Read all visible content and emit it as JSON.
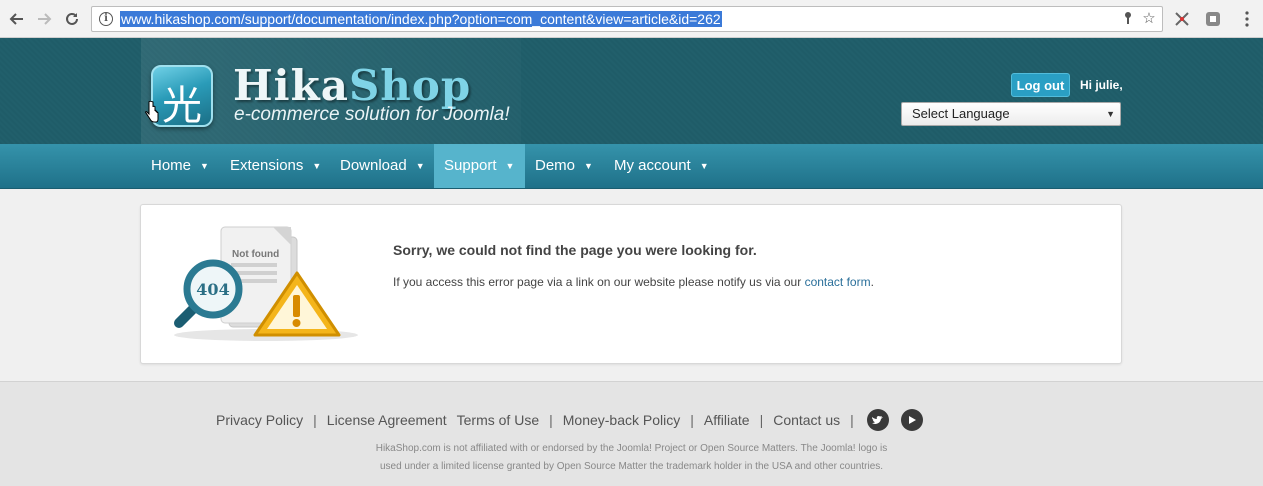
{
  "browser": {
    "url": "www.hikashop.com/support/documentation/index.php?option=com_content&view=article&id=262"
  },
  "header": {
    "logo_word_1": "Hika",
    "logo_word_2": "Shop",
    "tagline": "e-commerce solution for Joomla!",
    "logout_label": "Log out",
    "greeting": "Hi julie,",
    "language_select": "Select Language"
  },
  "menu": {
    "items": [
      {
        "label": "Home"
      },
      {
        "label": "Extensions"
      },
      {
        "label": "Download"
      },
      {
        "label": "Support"
      },
      {
        "label": "Demo"
      },
      {
        "label": "My account"
      }
    ],
    "caret": "▼"
  },
  "error": {
    "illustration_label": "Not found",
    "illustration_code": "404",
    "title": "Sorry, we could not find the page you were looking for.",
    "message": "If you access this error page via a link on our website please notify us via our",
    "link_text": "contact form",
    "message_end": "."
  },
  "footer": {
    "links": [
      "Privacy Policy",
      "License Agreement",
      "Terms of Use",
      "Money-back Policy",
      "Affiliate",
      "Contact us"
    ],
    "separator": "|",
    "note_line_1": "HikaShop.com is not affiliated with or endorsed by the Joomla! Project or Open Source Matters. The Joomla! logo is",
    "note_line_2": "used under a limited license granted by Open Source Matter the trademark holder in the USA and other countries."
  },
  "colors": {
    "header_bg": "#1f5c68",
    "menu_bg": "#2a86a0",
    "menu_active": "#56b4cc",
    "accent": "#2a9fc4"
  }
}
